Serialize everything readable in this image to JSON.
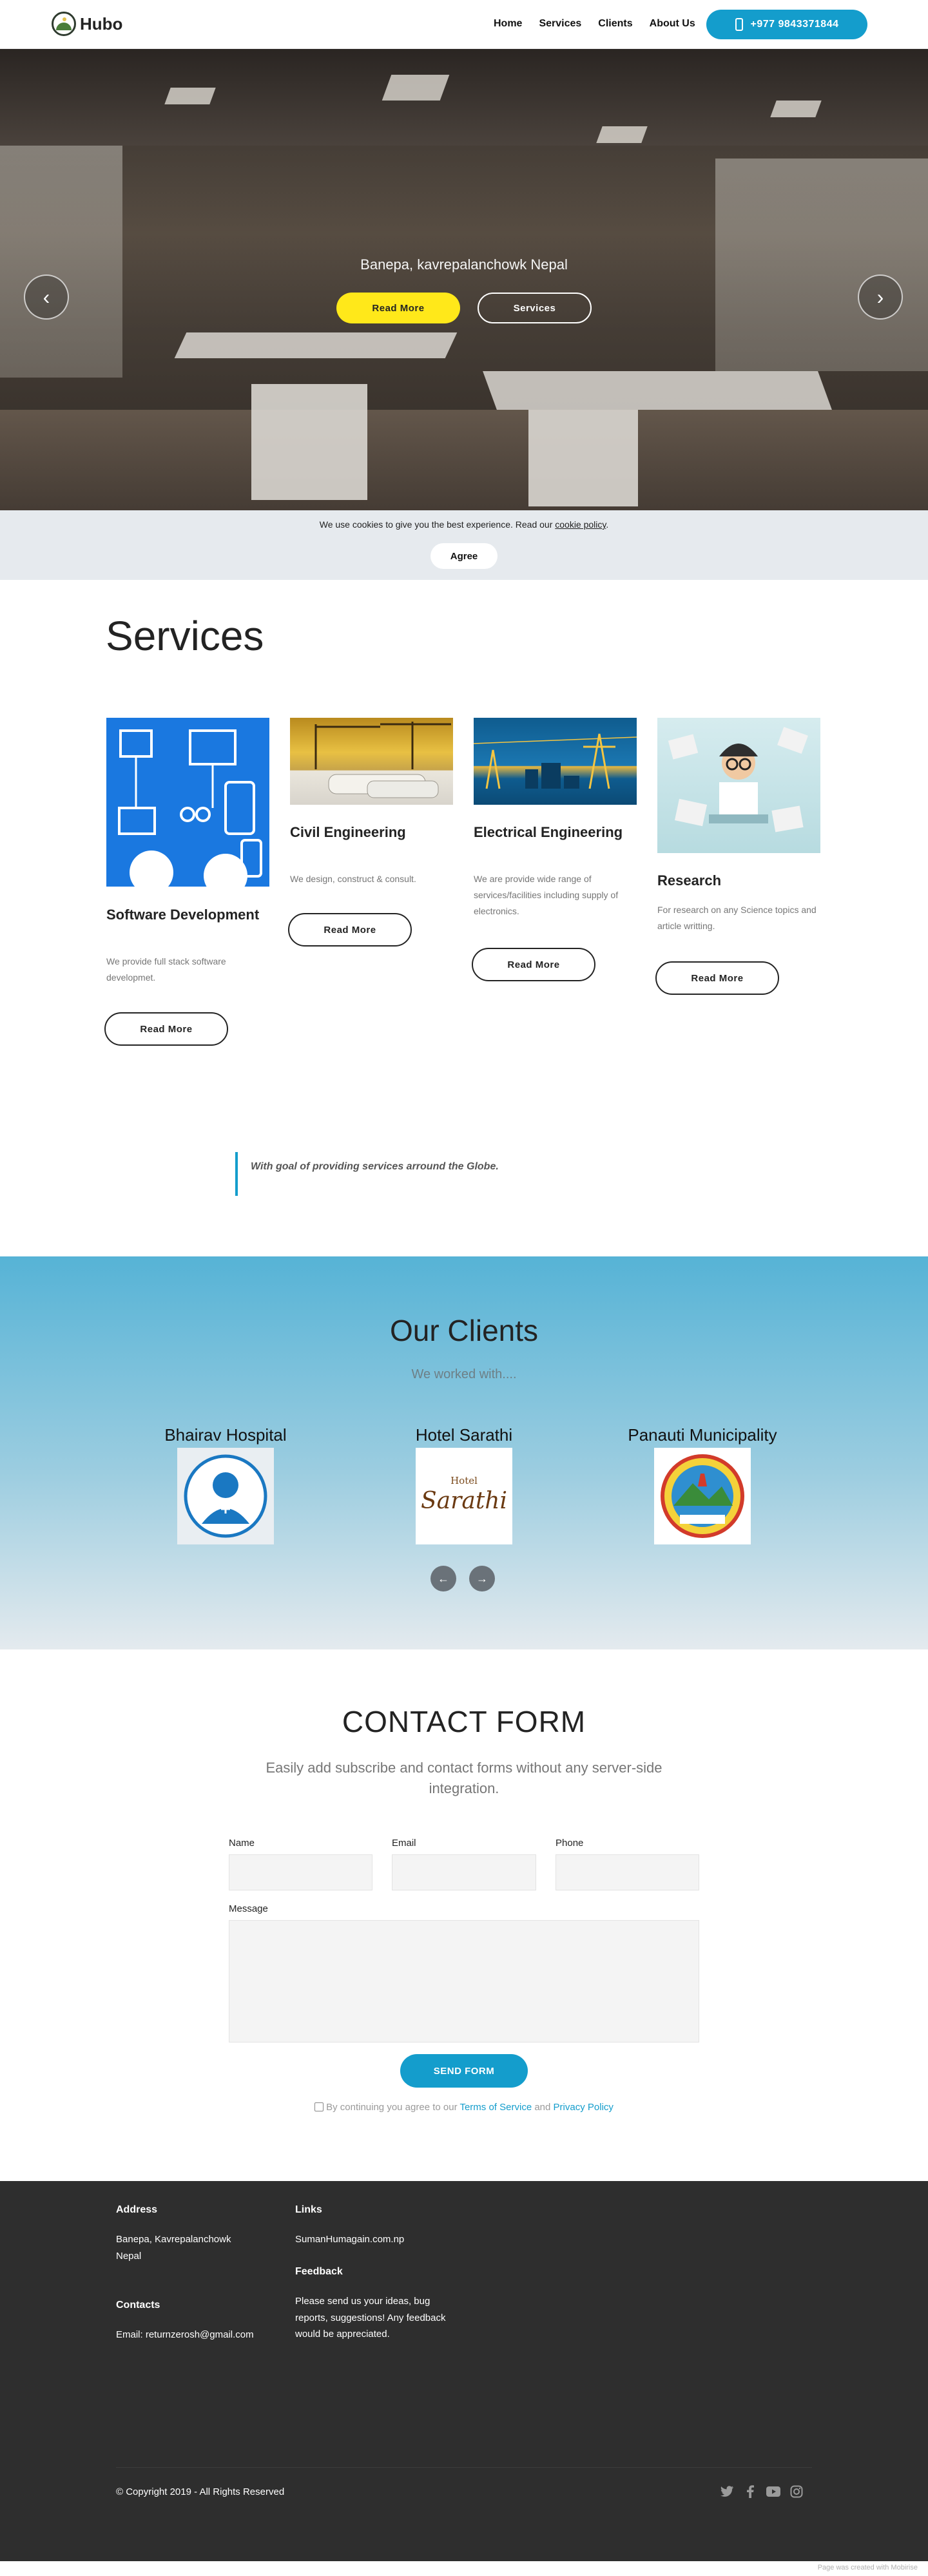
{
  "header": {
    "brand": "Hubo",
    "nav": [
      "Home",
      "Services",
      "Clients",
      "About Us"
    ],
    "phone": "+977 9843371844",
    "phone_icon": "mobile-phone-icon"
  },
  "hero": {
    "caption": "Banepa, kavrepalanchowk Nepal",
    "primary_button": "Read More",
    "secondary_button": "Services",
    "prev_icon": "arrow-left-icon",
    "next_icon": "arrow-right-icon"
  },
  "cookie": {
    "text": "We use cookies to give you the best experience. Read our ",
    "link": "cookie policy",
    "after": ".",
    "button": "Agree"
  },
  "services": {
    "title": "Services",
    "cards": [
      {
        "title": "Software Development",
        "text": "We provide full stack software developmet.",
        "button": "Read More"
      },
      {
        "title": "Civil Engineering",
        "text": "We design, construct & consult.",
        "button": "Read More"
      },
      {
        "title": "Electrical Engineering",
        "text": "We are provide wide range of services/facilities including supply of electronics.",
        "button": "Read More"
      },
      {
        "title": "Research",
        "text": "For research on any Science topics and article writting.",
        "button": "Read More"
      }
    ]
  },
  "quote": "With goal of providing services arround the Globe.",
  "clients": {
    "title": "Our Clients",
    "subtitle": "We worked with....",
    "items": [
      {
        "name": "Bhairav Hospital"
      },
      {
        "name": "Hotel Sarathi",
        "logo_text_small": "Hotel",
        "logo_text": "Sarathi"
      },
      {
        "name": "Panauti Municipality"
      }
    ]
  },
  "contact": {
    "title": "CONTACT FORM",
    "subtitle": "Easily add subscribe and contact forms without any server-side integration.",
    "fields": {
      "name": "Name",
      "email": "Email",
      "phone": "Phone",
      "message": "Message"
    },
    "button": "SEND FORM",
    "agree_pre": "By continuing you agree to our ",
    "terms": "Terms of Service",
    "and": " and ",
    "privacy": "Privacy Policy"
  },
  "footer": {
    "address_title": "Address",
    "address": "Banepa, Kavrepalanchowk Nepal",
    "contacts_title": "Contacts",
    "email": "Email: returnzerosh@gmail.com",
    "links_title": "Links",
    "link": "SumanHumagain.com.np",
    "feedback_title": "Feedback",
    "feedback": "Please send us your ideas, bug reports, suggestions! Any feedback would be appreciated.",
    "copyright": "© Copyright 2019 - All Rights Reserved",
    "social_icons": [
      "twitter-icon",
      "facebook-icon",
      "youtube-icon",
      "instagram-icon"
    ],
    "credit": "Page was created with Mobirise"
  }
}
